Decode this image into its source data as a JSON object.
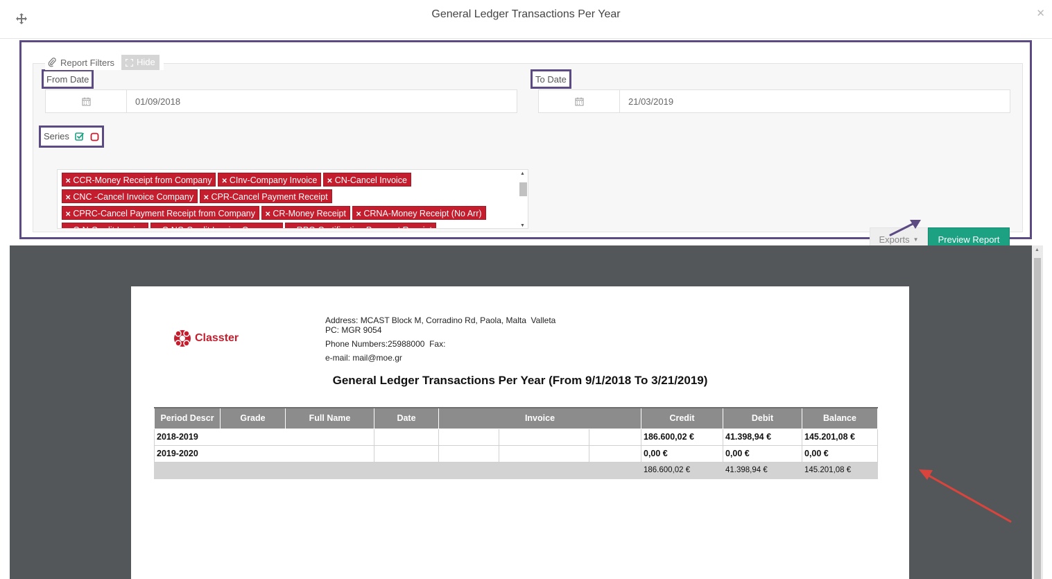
{
  "modal": {
    "title": "General Ledger Transactions Per Year"
  },
  "filters": {
    "legend": "Report Filters",
    "hide_label": "Hide",
    "from_date": {
      "label": "From Date",
      "value": "01/09/2018"
    },
    "to_date": {
      "label": "To Date",
      "value": "21/03/2019"
    },
    "series": {
      "label": "Series",
      "tags": [
        "CCR-Money Receipt from Company",
        "CInv-Company Invoice",
        "CN-Cancel Invoice",
        "CNC -Cancel Invoice Company",
        "CPR-Cancel Payment Receipt",
        "CPRC-Cancel Payment Receipt from Company",
        "CR-Money Receipt",
        "CRNA-Money Receipt (No Arr)",
        "CrN-Credit Invoice",
        "CrNC-Credit Invoice Company",
        "RPC-Certification Payment Receipt"
      ]
    },
    "exports_label": "Exports",
    "preview_label": "Preview Report"
  },
  "report": {
    "logo_text": "Classter",
    "address_line1": "Address: MCAST Block M, Corradino Rd, Paola, Malta  Valleta",
    "address_line2": "PC: MGR 9054",
    "phone_line": "Phone Numbers:25988000  Fax:",
    "email_line": "e-mail: mail@moe.gr",
    "title": "General Ledger Transactions Per Year (From 9/1/2018 To  3/21/2019)",
    "columns": [
      "Period Descr",
      "Grade",
      "Full Name",
      "Date",
      "Invoice",
      "Credit",
      "Debit",
      "Balance"
    ],
    "rows": [
      {
        "period": "2018-2019",
        "credit": "186.600,02 €",
        "debit": "41.398,94 €",
        "balance": "145.201,08 €"
      },
      {
        "period": "2019-2020",
        "credit": "0,00 €",
        "debit": "0,00 €",
        "balance": "0,00 €"
      }
    ],
    "totals": {
      "credit": "186.600,02 €",
      "debit": "41.398,94 €",
      "balance": "145.201,08 €"
    }
  },
  "colors": {
    "accent_teal": "#1ca283",
    "tag_red": "#c41e2e",
    "highlight_purple": "#5c4a82",
    "viewer_bg": "#54575a"
  }
}
